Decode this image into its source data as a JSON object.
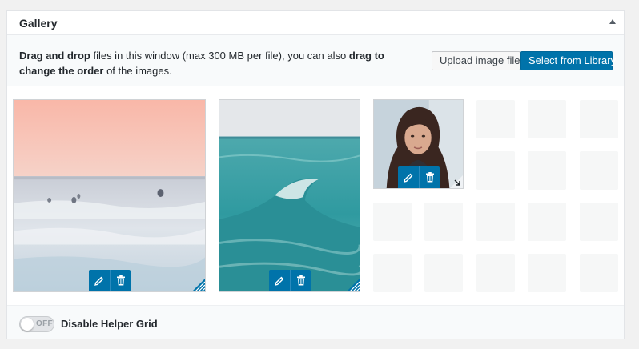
{
  "panel": {
    "title": "Gallery",
    "collapse_icon": "caret-up-icon"
  },
  "instructions": {
    "part1": "Drag and drop",
    "part2": " files in this window (max 300 MB per file), you can also ",
    "part3": "drag to change the order",
    "part4": " of the images."
  },
  "buttons": {
    "upload_label": "Upload image files",
    "library_label": "Select from Library"
  },
  "gallery": {
    "images": [
      {
        "name": "misty-ocean-surfers",
        "edit_icon": "pencil-icon",
        "delete_icon": "trash-icon"
      },
      {
        "name": "teal-ocean-wave",
        "edit_icon": "pencil-icon",
        "delete_icon": "trash-icon"
      },
      {
        "name": "woman-portrait",
        "edit_icon": "pencil-icon",
        "delete_icon": "trash-icon"
      }
    ]
  },
  "footer": {
    "toggle_state": "OFF",
    "toggle_label": "Disable Helper Grid"
  },
  "colors": {
    "primary": "#0073aa",
    "placeholder": "#f6f7f7"
  }
}
